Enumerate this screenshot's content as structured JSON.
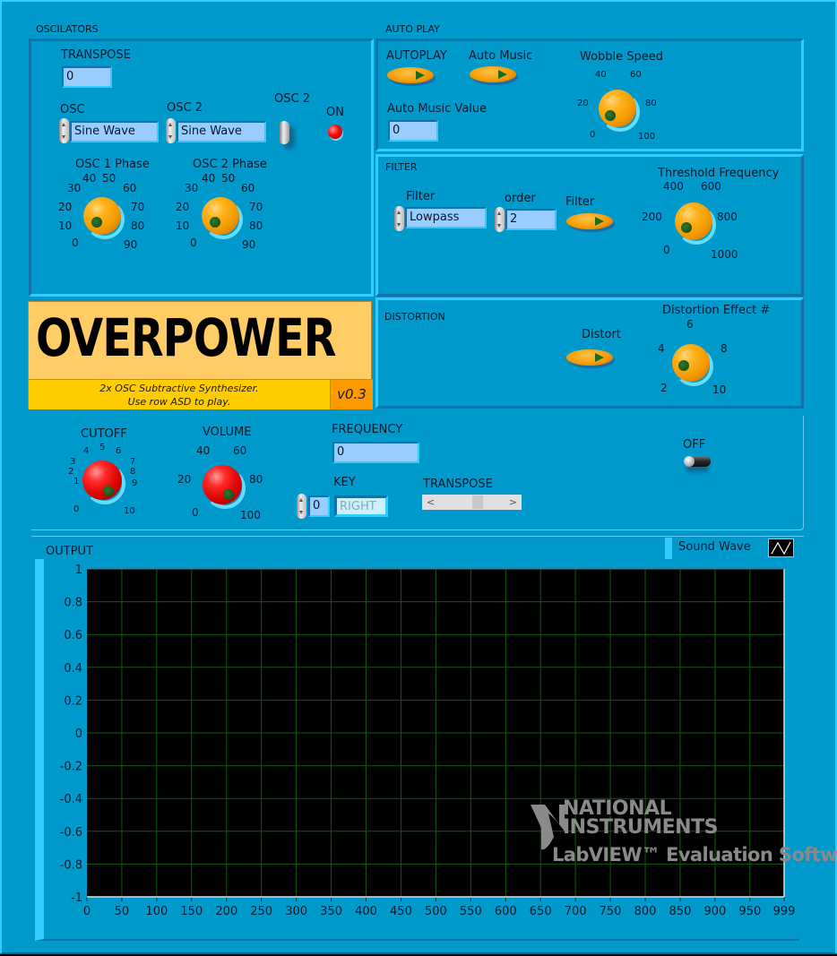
{
  "app": {
    "banner": {
      "title": "OVERPOWER",
      "subtitle_line1": "2x OSC Subtractive Synthesizer.",
      "subtitle_line2": "Use row ASD to play.",
      "version": "v0.3"
    }
  },
  "oscillators": {
    "section_title": "OSCILATORS",
    "transpose": {
      "label": "TRANSPOSE",
      "value": "0"
    },
    "osc1": {
      "label": "OSC",
      "value": "Sine Wave"
    },
    "osc2": {
      "label": "OSC 2",
      "value": "Sine Wave"
    },
    "osc2_switch": {
      "label": "OSC 2",
      "state": "on"
    },
    "osc2_led": {
      "label": "ON",
      "state": "on",
      "color": "#ff0000"
    },
    "osc1_phase": {
      "label": "OSC 1 Phase",
      "ticks": [
        "0",
        "10",
        "20",
        "30",
        "40",
        "50",
        "60",
        "70",
        "80",
        "90"
      ],
      "value": 0
    },
    "osc2_phase": {
      "label": "OSC 2 Phase",
      "ticks": [
        "0",
        "10",
        "20",
        "30",
        "40",
        "50",
        "60",
        "70",
        "80",
        "90"
      ],
      "value": 0
    }
  },
  "autoplay": {
    "section_title": "AUTO PLAY",
    "autoplay_button": {
      "label": "AUTOPLAY",
      "state": "off"
    },
    "auto_music_button": {
      "label": "Auto Music",
      "state": "off"
    },
    "auto_music_value": {
      "label": "Auto Music Value",
      "value": "0"
    },
    "wobble_speed": {
      "label": "Wobble Speed",
      "ticks": [
        "0",
        "20",
        "40",
        "60",
        "80",
        "100"
      ],
      "value": 0
    }
  },
  "filter": {
    "section_title": "FILTER",
    "filter_type": {
      "label": "Filter",
      "value": "Lowpass"
    },
    "order": {
      "label": "order",
      "value": "2"
    },
    "filter_button": {
      "label": "Filter",
      "state": "off"
    },
    "threshold_frequency": {
      "label": "Threshold Frequency",
      "ticks": [
        "0",
        "200",
        "400",
        "600",
        "800",
        "1000"
      ],
      "value": 0
    }
  },
  "distortion": {
    "section_title": "DISTORTION",
    "distort_button": {
      "label": "Distort",
      "state": "off"
    },
    "effect": {
      "label": "Distortion Effect #",
      "ticks": [
        "2",
        "4",
        "6",
        "8",
        "10"
      ],
      "value": 2
    }
  },
  "main_controls": {
    "cutoff": {
      "label": "CUTOFF",
      "ticks": [
        "0",
        "1",
        "2",
        "3",
        "4",
        "5",
        "6",
        "7",
        "8",
        "9",
        "10"
      ],
      "value": 10
    },
    "volume": {
      "label": "VOLUME",
      "ticks": [
        "0",
        "20",
        "40",
        "60",
        "80",
        "100"
      ],
      "value": 100
    },
    "frequency": {
      "label": "FREQUENCY",
      "value": "0"
    },
    "key": {
      "label": "KEY",
      "index_value": "0",
      "value": "RIGHT"
    },
    "transpose_slider": {
      "label": "TRANSPOSE",
      "left_arrow": "<",
      "right_arrow": ">"
    },
    "power_switch": {
      "label": "OFF",
      "state": "off"
    }
  },
  "output": {
    "title": "OUTPUT",
    "legend": {
      "label": "Sound Wave"
    },
    "watermark_line1": "NATIONAL",
    "watermark_line2": "INSTRUMENTS",
    "watermark_line3": "LabVIEW™ Evaluation Software"
  },
  "chart_data": {
    "type": "line",
    "title": "OUTPUT",
    "xlabel": "",
    "ylabel": "",
    "xlim": [
      0,
      999
    ],
    "ylim": [
      -1,
      1
    ],
    "x_ticks": [
      "0",
      "50",
      "100",
      "150",
      "200",
      "250",
      "300",
      "350",
      "400",
      "450",
      "500",
      "550",
      "600",
      "650",
      "700",
      "750",
      "800",
      "850",
      "900",
      "950",
      "999"
    ],
    "y_ticks": [
      "1",
      "0.8",
      "0.6",
      "0.4",
      "0.2",
      "0",
      "-0.2",
      "-0.4",
      "-0.6",
      "-0.8",
      "-1"
    ],
    "grid": true,
    "legend": "top-right",
    "series": [
      {
        "name": "Sound Wave",
        "values": []
      }
    ],
    "colors": {
      "plot_bg": "#000000",
      "grid": "#0f5a0f"
    }
  }
}
